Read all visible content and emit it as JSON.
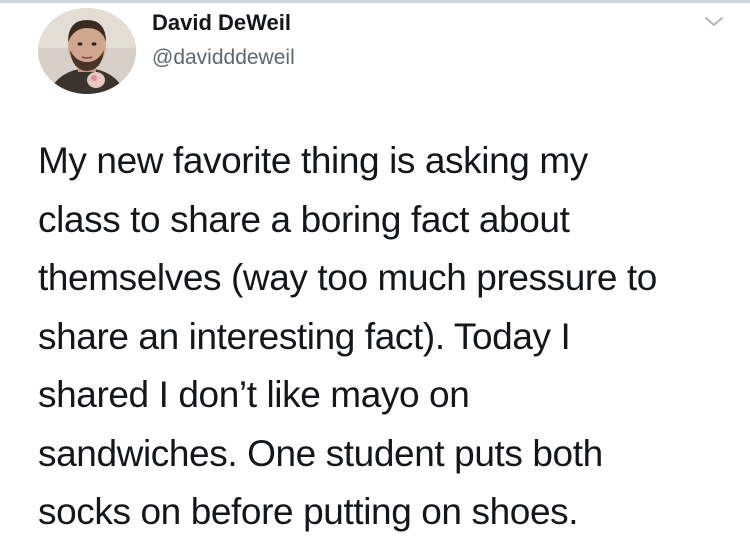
{
  "tweet": {
    "author": {
      "display_name": "David DeWeil",
      "handle": "@davidddeweil",
      "avatar_icon": "profile-photo"
    },
    "menu_icon": "chevron-down-icon",
    "text_lines": [
      "My new favorite thing is asking my",
      "class to share a boring fact about",
      "themselves (way too much pressure to",
      "share an interesting fact). Today I",
      "shared I don’t like mayo on",
      "sandwiches. One student puts both",
      "socks on before putting on shoes."
    ]
  },
  "colors": {
    "text_primary": "#14171a",
    "text_secondary": "#5b6873",
    "caret": "#aab8c2",
    "divider": "#cfd5da"
  }
}
